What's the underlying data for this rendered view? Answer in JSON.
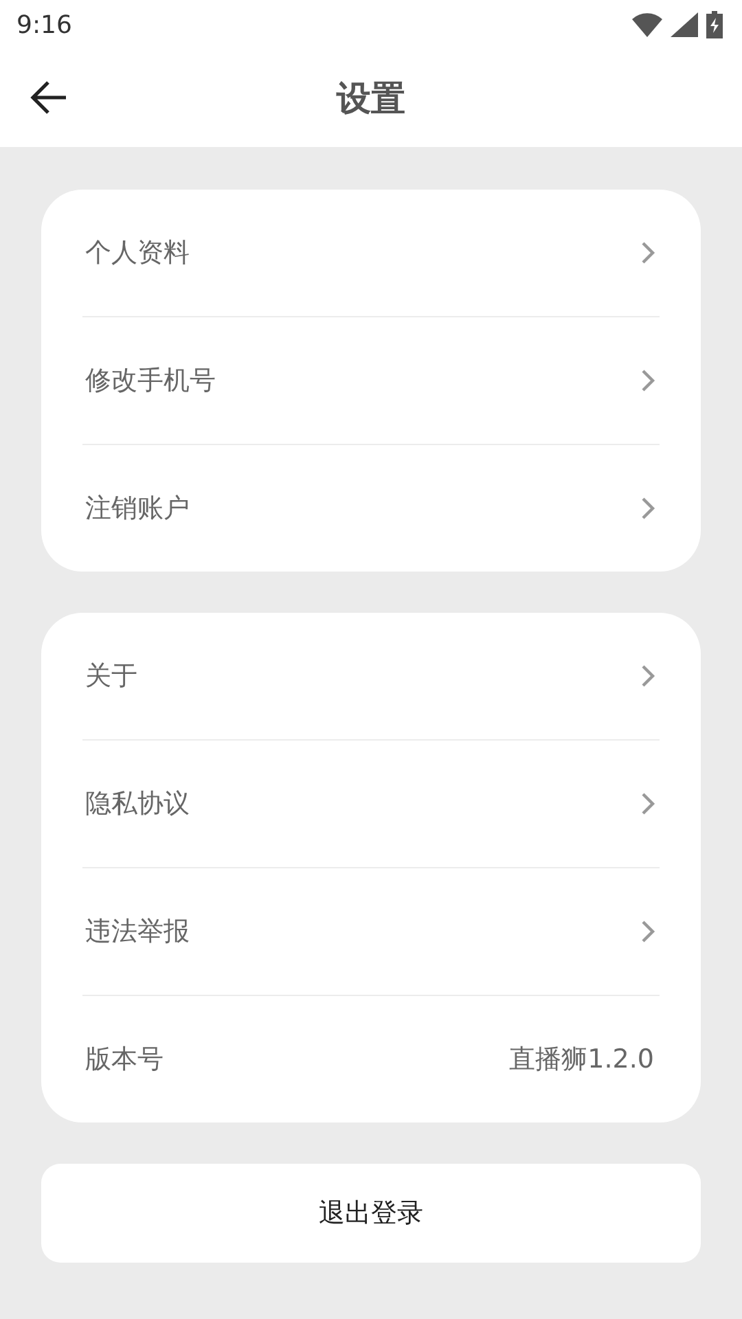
{
  "status_bar": {
    "time": "9:16"
  },
  "header": {
    "title": "设置"
  },
  "groups": [
    {
      "items": [
        {
          "kind": "link",
          "label": "个人资料"
        },
        {
          "kind": "link",
          "label": "修改手机号"
        },
        {
          "kind": "link",
          "label": "注销账户"
        }
      ]
    },
    {
      "items": [
        {
          "kind": "link",
          "label": "关于"
        },
        {
          "kind": "link",
          "label": "隐私协议"
        },
        {
          "kind": "link",
          "label": "违法举报"
        },
        {
          "kind": "value",
          "label": "版本号",
          "value": "直播狮1.2.0"
        }
      ]
    }
  ],
  "logout_button": "退出登录"
}
